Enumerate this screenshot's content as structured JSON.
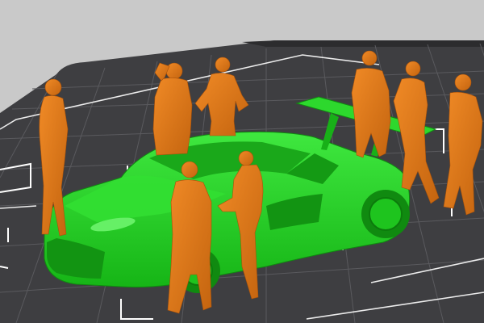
{
  "viewport": {
    "background_color": "#c9c9c9",
    "bed_color": "#3e3e41",
    "grid_line_color": "#5a5a5e",
    "bed_edge_color": "#ffffff",
    "selection_box_color": "#ffffff"
  },
  "objects": [
    {
      "id": "race-car",
      "color": "#1fd21f"
    },
    {
      "id": "person-left-standing",
      "color": "#e07a1a"
    },
    {
      "id": "person-hand-on-head",
      "color": "#e07a1a"
    },
    {
      "id": "person-hands-on-hips",
      "color": "#e07a1a"
    },
    {
      "id": "person-front-left",
      "color": "#e07a1a"
    },
    {
      "id": "person-front-woman",
      "color": "#e07a1a"
    },
    {
      "id": "person-back-right",
      "color": "#e07a1a"
    },
    {
      "id": "person-right-pair",
      "color": "#e07a1a"
    },
    {
      "id": "person-far-right",
      "color": "#e07a1a"
    }
  ]
}
